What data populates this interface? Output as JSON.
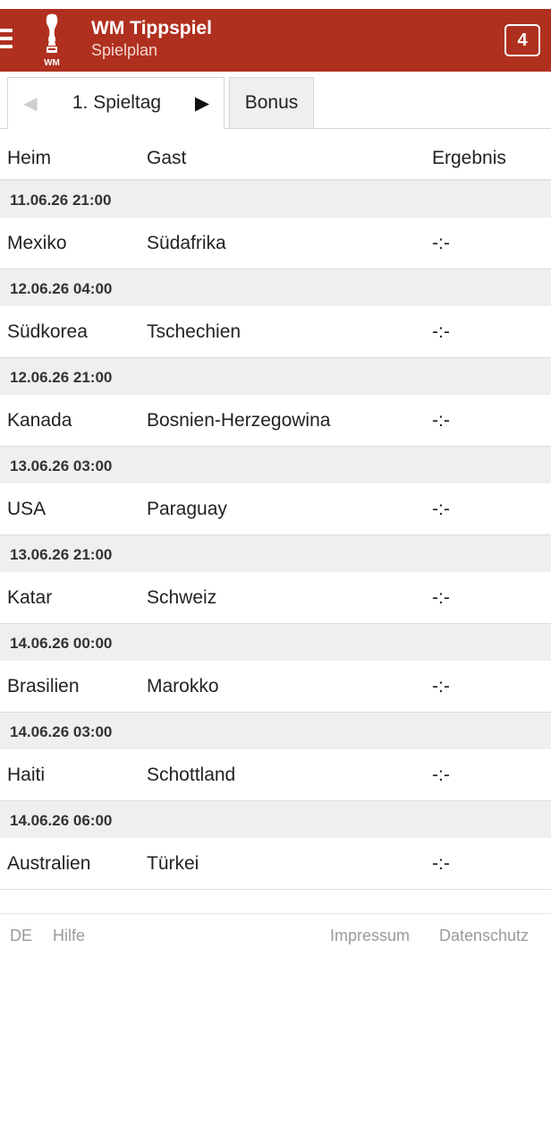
{
  "header": {
    "title": "WM Tippspiel",
    "subtitle": "Spielplan",
    "logo_text": "WM",
    "badge": "4",
    "color": "#b0301f"
  },
  "tabs": {
    "prev_icon": "◀",
    "active_label": "1. Spieltag",
    "next_icon": "▶",
    "bonus_label": "Bonus"
  },
  "table": {
    "columns": {
      "home": "Heim",
      "guest": "Gast",
      "result": "Ergebnis"
    },
    "matches": [
      {
        "date": "11.06.26 21:00",
        "home": "Mexiko",
        "guest": "Südafrika",
        "result": "-:-"
      },
      {
        "date": "12.06.26 04:00",
        "home": "Südkorea",
        "guest": "Tschechien",
        "result": "-:-"
      },
      {
        "date": "12.06.26 21:00",
        "home": "Kanada",
        "guest": "Bosnien-Herzegowina",
        "result": "-:-"
      },
      {
        "date": "13.06.26 03:00",
        "home": "USA",
        "guest": "Paraguay",
        "result": "-:-"
      },
      {
        "date": "13.06.26 21:00",
        "home": "Katar",
        "guest": "Schweiz",
        "result": "-:-"
      },
      {
        "date": "14.06.26 00:00",
        "home": "Brasilien",
        "guest": "Marokko",
        "result": "-:-"
      },
      {
        "date": "14.06.26 03:00",
        "home": "Haiti",
        "guest": "Schottland",
        "result": "-:-"
      },
      {
        "date": "14.06.26 06:00",
        "home": "Australien",
        "guest": "Türkei",
        "result": "-:-"
      }
    ]
  },
  "footer": {
    "lang": "DE",
    "help": "Hilfe",
    "imprint": "Impressum",
    "privacy": "Datenschutz"
  }
}
